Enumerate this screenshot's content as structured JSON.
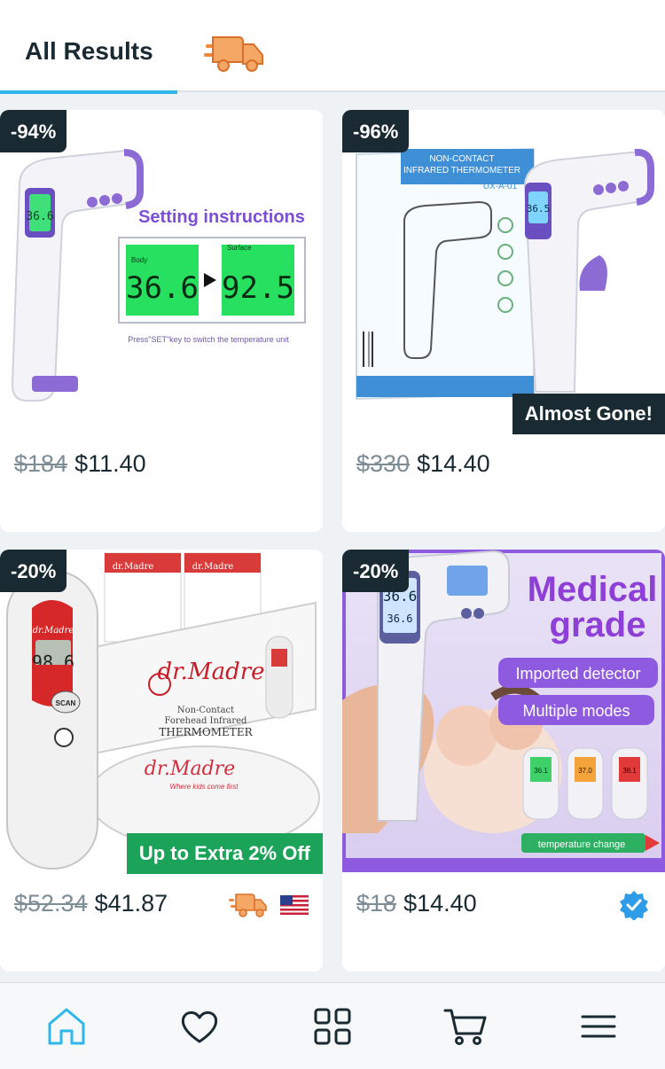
{
  "tabs": {
    "all_results": "All Results",
    "express_icon": "delivery-truck-icon"
  },
  "products": [
    {
      "discount": "-94%",
      "old_price": "$184",
      "new_price": "$11.40",
      "ribbon": "",
      "image": "infrared-thermometer-setting-instructions",
      "image_text": {
        "title": "Setting instructions",
        "body": "Body",
        "surface": "Surface",
        "body_temp": "36.6",
        "surface_temp": "92.5",
        "note": "Press\"SET\"key to switch the temperature unit"
      }
    },
    {
      "discount": "-96%",
      "old_price": "$330",
      "new_price": "$14.40",
      "ribbon": "Almost Gone!",
      "image": "non-contact-thermometer-box",
      "image_text": {
        "box_line1": "NON-CONTACT",
        "box_line2": "INFRARED THERMOMETER",
        "model": "UX-A-01",
        "screen": "36.5"
      }
    },
    {
      "discount": "-20%",
      "old_price": "$52.34",
      "new_price": "$41.87",
      "ribbon": "Up to Extra 2% Off",
      "image": "dr-madre-forehead-thermometer",
      "image_text": {
        "brand": "dr.Madre",
        "tagline": "Where kids come first",
        "line1": "Non-Contact",
        "line2": "Forehead Infrared",
        "line3": "THERMOMETER",
        "screen": "98.6",
        "scan": "SCAN"
      },
      "badges": [
        "delivery-truck-icon",
        "us-flag-icon"
      ]
    },
    {
      "discount": "-20%",
      "old_price": "$18",
      "new_price": "$14.40",
      "ribbon": "",
      "image": "medical-grade-thermometer",
      "image_text": {
        "title1": "Medical",
        "title2": "grade",
        "pill1": "Imported detector",
        "pill2": "Multiple modes",
        "footer": "temperature change",
        "screen1": "36.6",
        "screen2": "36.6",
        "t1": "36.1",
        "t2": "37.0",
        "t3": "38.1"
      },
      "badges": [
        "verified-check-icon"
      ]
    }
  ],
  "bottom_nav": [
    "home-icon",
    "heart-icon",
    "grid-icon",
    "cart-icon",
    "menu-icon"
  ],
  "colors": {
    "accent": "#2fb7ec",
    "dark": "#192a32",
    "green": "#1ca35a",
    "truck": "#f0883e"
  }
}
